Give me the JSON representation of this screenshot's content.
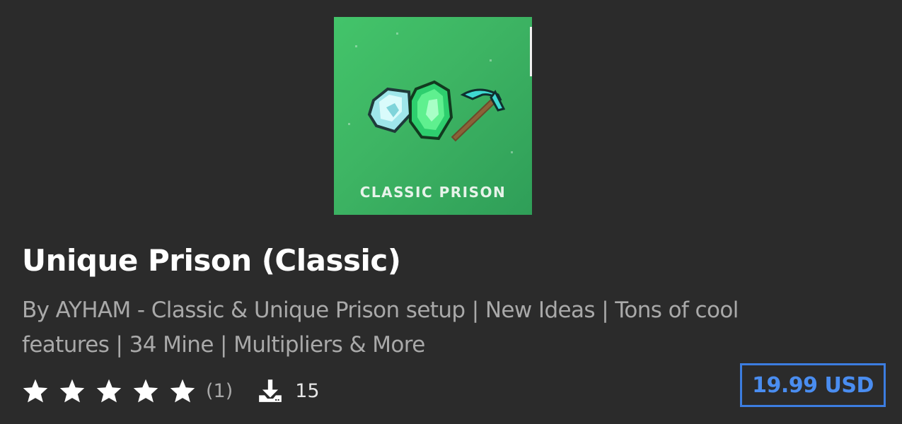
{
  "product": {
    "thumbnail_caption": "CLASSIC PRISON",
    "title": "Unique Prison (Classic)",
    "subtitle": "By AYHAM - Classic & Unique Prison setup | New Ideas | Tons of cool features | 34 Mine | Multipliers & More",
    "rating": {
      "stars": 5,
      "max_stars": 5,
      "count_label": "(1)"
    },
    "downloads": "15",
    "price": "19.99 USD"
  },
  "icons": {
    "star": "star-icon",
    "download": "download-icon"
  },
  "colors": {
    "background": "#2b2b2b",
    "title": "#ffffff",
    "subtitle": "#a9a9a9",
    "price_accent": "#4a8df0",
    "thumbnail_green": "#43c46a"
  }
}
